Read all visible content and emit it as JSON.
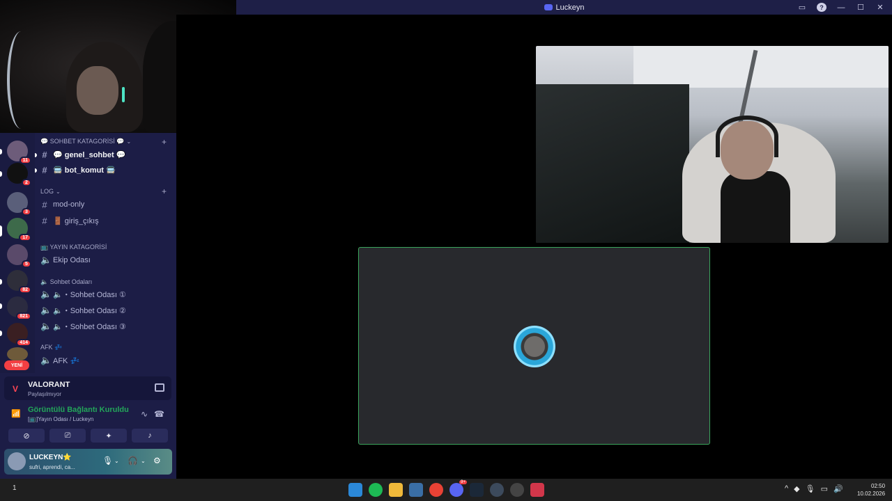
{
  "window": {
    "title": "Luckeyn"
  },
  "servers": [
    {
      "badge": "11"
    },
    {
      "badge": "2"
    },
    {
      "badge": "3"
    },
    {
      "badge": "17"
    },
    {
      "badge": "5"
    },
    {
      "badge": "82"
    },
    {
      "badge": "821"
    },
    {
      "badge": "414"
    }
  ],
  "new_label": "YENİ",
  "channels": {
    "cat_sohbet": "💬 SOHBET KATAGORİSİ 💬",
    "genel_sohbet": "💬 genel_sohbet 💬",
    "bot_komut": "🚍 bot_komut 🚍",
    "cat_log": "LOG",
    "mod_only": "mod-only",
    "giris_cikis": "🚪 giriş_çıkış",
    "cat_yayin": "📺 YAYIN KATAGORİSİ",
    "ekip_odasi": "Ekip Odası",
    "cat_sohbet_odalari": "🔈 Sohbet Odaları",
    "sohbet_1": "🔈・Sohbet Odası ①",
    "sohbet_2": "🔈・Sohbet Odası ②",
    "sohbet_3": "🔈・Sohbet Odası ③",
    "cat_afk": "AFK 💤",
    "afk": "AFK 💤"
  },
  "activity": {
    "name": "VALORANT",
    "status": "Paylaşılmıyor"
  },
  "connection": {
    "title": "Görüntülü Bağlantı Kuruldu",
    "subtitle": "[📺]Yayın Odası / Luckeyn"
  },
  "user": {
    "name": "LUCKEYN⭐",
    "status": "sufri, aprendi, ca..."
  },
  "taskbar": {
    "left_text": "1",
    "time": "02:50",
    "date": "10.02.2026",
    "discord_badge": "9+"
  },
  "colors": {
    "accent": "#5865f2",
    "connected": "#23a55a",
    "speaking_border": "#3ba55c",
    "badge": "#f23f43"
  }
}
